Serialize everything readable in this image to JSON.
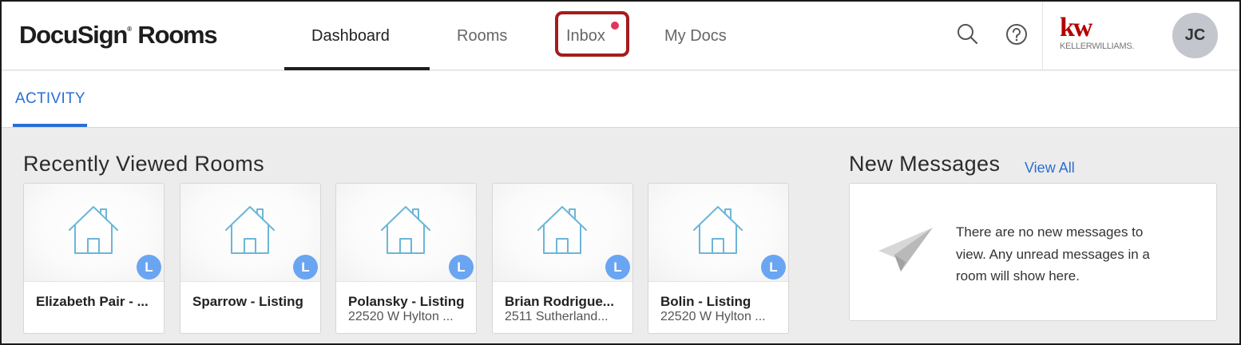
{
  "app": {
    "logo": "DocuSign",
    "logo_mark": "®",
    "logo_suffix": "Rooms"
  },
  "nav": {
    "dashboard": "Dashboard",
    "rooms": "Rooms",
    "inbox": "Inbox",
    "my_docs": "My Docs"
  },
  "brand": {
    "mark": "kw",
    "name": "KELLERWILLIAMS."
  },
  "user": {
    "initials": "JC"
  },
  "tabs": {
    "activity": "ACTIVITY"
  },
  "recent": {
    "title": "Recently Viewed Rooms",
    "rooms": [
      {
        "title": "Elizabeth Pair - ...",
        "subtitle": "",
        "badge": "L"
      },
      {
        "title": "Sparrow - Listing",
        "subtitle": "",
        "badge": "L"
      },
      {
        "title": "Polansky - Listing",
        "subtitle": "22520 W Hylton ...",
        "badge": "L"
      },
      {
        "title": "Brian Rodrigue...",
        "subtitle": "2511 Sutherland...",
        "badge": "L"
      },
      {
        "title": "Bolin - Listing",
        "subtitle": "22520 W Hylton ...",
        "badge": "L"
      }
    ]
  },
  "messages": {
    "title": "New Messages",
    "view_all": "View All",
    "empty_line1": "There are no new messages to",
    "empty_line2": "view. Any unread messages in a",
    "empty_line3": "room will show here."
  },
  "colors": {
    "accent": "#2a6ed6",
    "badge": "#6aa5f2",
    "notify": "#e0355e",
    "highlight": "#a51c1c",
    "brand": "#b40101"
  }
}
